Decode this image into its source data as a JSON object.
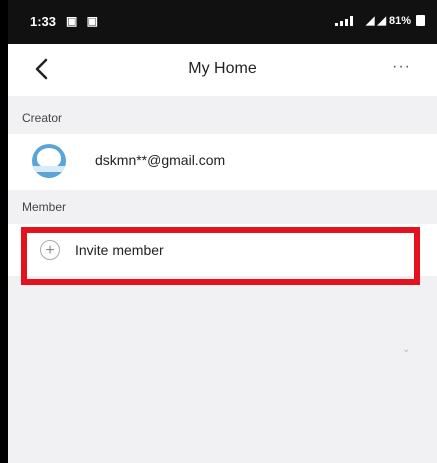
{
  "status_bar": {
    "time": "1:33",
    "left_icons": "▣ ▣",
    "right_text": "◢ ◢ 81%"
  },
  "header": {
    "title": "My Home",
    "more": "···"
  },
  "creator": {
    "section_label": "Creator",
    "email": "dskmn**@gmail.com"
  },
  "member": {
    "section_label": "Member",
    "invite_label": "Invite member"
  },
  "colors": {
    "highlight": "#e3121d",
    "avatar": "#5aa4d8"
  }
}
